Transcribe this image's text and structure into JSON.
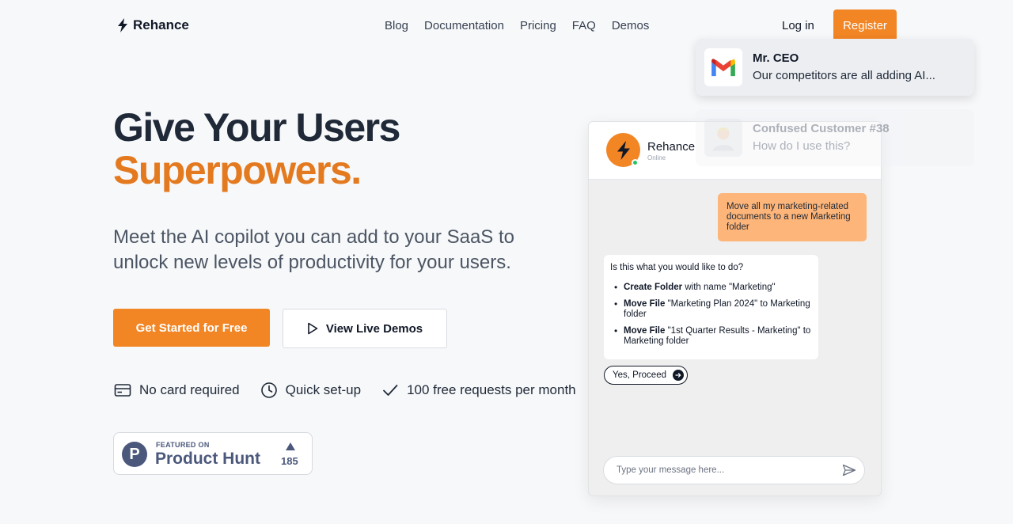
{
  "brand": {
    "name": "Rehance"
  },
  "nav": {
    "links": [
      "Blog",
      "Documentation",
      "Pricing",
      "FAQ",
      "Demos"
    ],
    "login": "Log in",
    "register": "Register"
  },
  "hero": {
    "title_line1": "Give Your Users",
    "title_line2": "Superpowers.",
    "subtitle": "Meet the AI copilot you can add to your SaaS to unlock new levels of productivity for your users.",
    "primary_cta": "Get Started for Free",
    "secondary_cta": "View Live Demos",
    "features": [
      {
        "icon": "credit-card-icon",
        "label": "No card required"
      },
      {
        "icon": "clock-icon",
        "label": "Quick set-up"
      },
      {
        "icon": "check-icon",
        "label": "100 free requests per month"
      }
    ]
  },
  "product_hunt": {
    "featured": "FEATURED ON",
    "name": "Product Hunt",
    "count": "185"
  },
  "chat": {
    "name": "Rehance",
    "status": "Online",
    "user_message": "Move all my marketing-related documents to a new Marketing folder",
    "bot_question": "Is this what you would like to do?",
    "actions": [
      {
        "verb": "Create Folder",
        "detail": " with name \"Marketing\""
      },
      {
        "verb": "Move File",
        "detail": " \"Marketing Plan 2024\" to Marketing folder"
      },
      {
        "verb": "Move File",
        "detail": " \"1st Quarter Results - Marketing\" to Marketing folder"
      }
    ],
    "proceed": "Yes, Proceed",
    "input_placeholder": "Type your message here..."
  },
  "notifications": [
    {
      "title": "Mr. CEO",
      "text": "Our competitors are all adding AI...",
      "icon": "gmail-icon"
    },
    {
      "title": "Confused Customer #38",
      "text": "How do I use this?",
      "icon": "avatar"
    }
  ],
  "colors": {
    "accent": "#f28524",
    "accent_text": "#e47a20",
    "user_bubble": "#fdb579",
    "ph": "#4b587c"
  }
}
